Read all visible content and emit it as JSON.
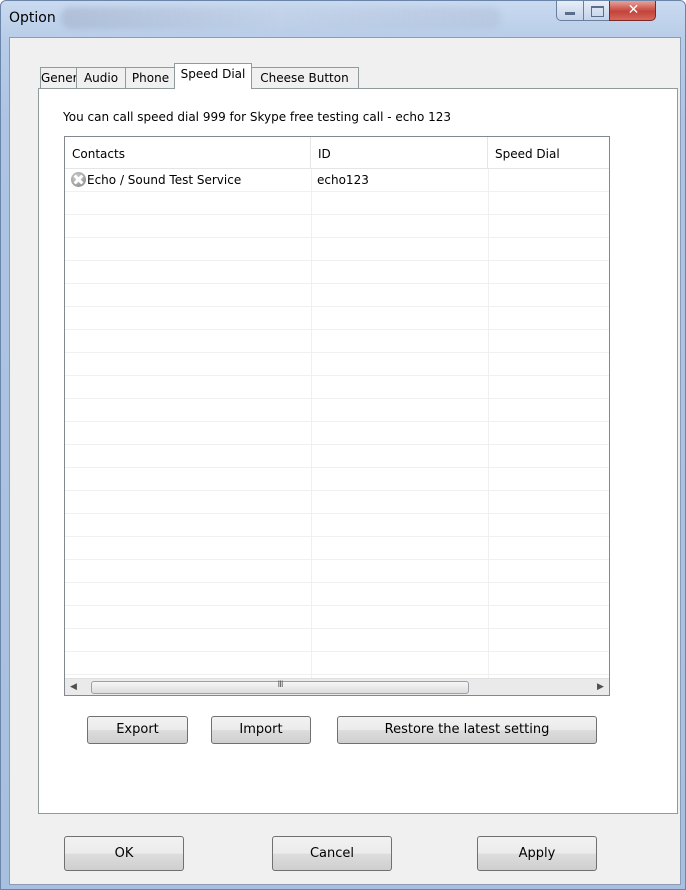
{
  "window": {
    "title": "Option"
  },
  "tabs": [
    "General",
    "Audio",
    "Phone",
    "Speed Dial",
    "Cheese Button"
  ],
  "active_tab": "Speed Dial",
  "speed_dial": {
    "info": "You can call speed dial 999 for Skype free testing call - echo 123",
    "columns": [
      "Contacts",
      "ID",
      "Speed Dial"
    ],
    "rows": [
      {
        "contact": "Echo / Sound Test Service",
        "id": "echo123",
        "speed_dial": "",
        "status_icon": "offline-status-icon"
      }
    ],
    "scrollbar_grip": "III",
    "buttons": {
      "export": "Export",
      "import": "Import",
      "restore": "Restore the latest setting"
    }
  },
  "footer": {
    "ok": "OK",
    "cancel": "Cancel",
    "apply": "Apply"
  }
}
